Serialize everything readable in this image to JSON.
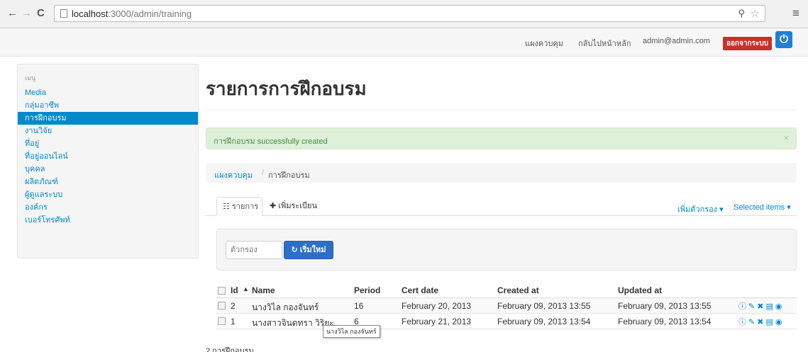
{
  "browser": {
    "url_host": "localhost",
    "url_rest": ":3000/admin/training"
  },
  "topnav": {
    "dashboard": "แผงควบคุม",
    "back_home": "กลับไปหน้าหลัก",
    "user_email": "admin@admin.com",
    "logout": "ออกจากระบบ"
  },
  "sidebar": {
    "header": "เมนู",
    "items": [
      {
        "label": "Media"
      },
      {
        "label": "กลุ่มอาชีพ"
      },
      {
        "label": "การฝึกอบรม"
      },
      {
        "label": "งานวิจัย"
      },
      {
        "label": "ที่อยู่"
      },
      {
        "label": "ที่อยู่ออนไลน์"
      },
      {
        "label": "บุคคล"
      },
      {
        "label": "ผลิตภัณฑ์"
      },
      {
        "label": "ผู้ดูแลระบบ"
      },
      {
        "label": "องค์กร"
      },
      {
        "label": "เบอร์โทรศัพท์"
      }
    ],
    "active_index": 2
  },
  "main": {
    "title": "รายการการฝึกอบรม",
    "alert": "การฝึกอบรม successfully created",
    "alert_close": "×",
    "breadcrumb": {
      "home": "แผงควบคุม",
      "separator": "/",
      "current": "การฝึกอบรม"
    },
    "tabs": {
      "list": "รายการ",
      "add": "เพิ่มระเบียน"
    },
    "add_filter": "เพิ่มตัวกรอง ▾",
    "selected_items": "Selected items ▾",
    "filter": {
      "placeholder": "ตัวกรอง",
      "reset": "เริ่มใหม่"
    }
  },
  "table": {
    "columns": {
      "id": "Id",
      "name": "Name",
      "period": "Period",
      "cert_date": "Cert date",
      "created_at": "Created at",
      "updated_at": "Updated at"
    },
    "rows": [
      {
        "id": "2",
        "name": "นางวิไล กองจันทร์",
        "period": "16",
        "cert_date": "February 20, 2013",
        "created_at": "February 09, 2013 13:55",
        "updated_at": "February 09, 2013 13:55"
      },
      {
        "id": "1",
        "name": "นางสาวจินดทรา วิริยะ",
        "period": "6",
        "cert_date": "February 21, 2013",
        "created_at": "February 09, 2013 13:54",
        "updated_at": "February 09, 2013 13:54"
      }
    ],
    "tooltip": "นางวิไล กองจันทร์",
    "count": "2 การฝึกอบรม"
  },
  "icons": {
    "row_actions": [
      "info-icon",
      "edit-icon",
      "delete-icon",
      "export-icon",
      "show-icon"
    ]
  },
  "colors": {
    "primary": "#0088cc",
    "logout": "#c9302c",
    "power": "#1e7fd6",
    "success_bg": "#dff0d8",
    "success_text": "#468847"
  }
}
